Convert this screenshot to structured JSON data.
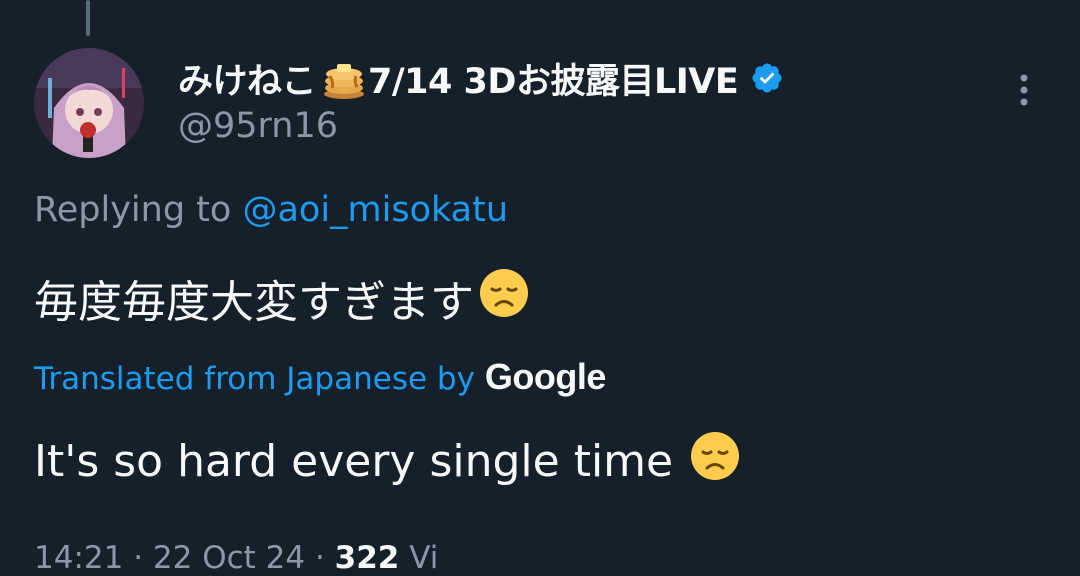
{
  "tweet": {
    "author": {
      "display_name_part1": "みけねこ",
      "display_name_part2": "7/14 3Dお披露目LIVE",
      "handle": "@95rn16",
      "verified": true,
      "name_emoji": "pancakes-icon"
    },
    "replying_prefix": "Replying to",
    "replying_to": "@aoi_misokatu",
    "text": "毎度毎度大変すぎます",
    "translated_label": "Translated from Japanese by",
    "translator": "Google",
    "translation": "It's so hard every single time",
    "meta_time": "14:21 · 22 Oct 24 ·",
    "meta_views_count": "322",
    "meta_views_label": "Vi"
  },
  "colors": {
    "background": "#15202b",
    "accent": "#1d9bf0",
    "secondary_text": "#8b98a5",
    "primary_text": "#f7f9f9"
  }
}
